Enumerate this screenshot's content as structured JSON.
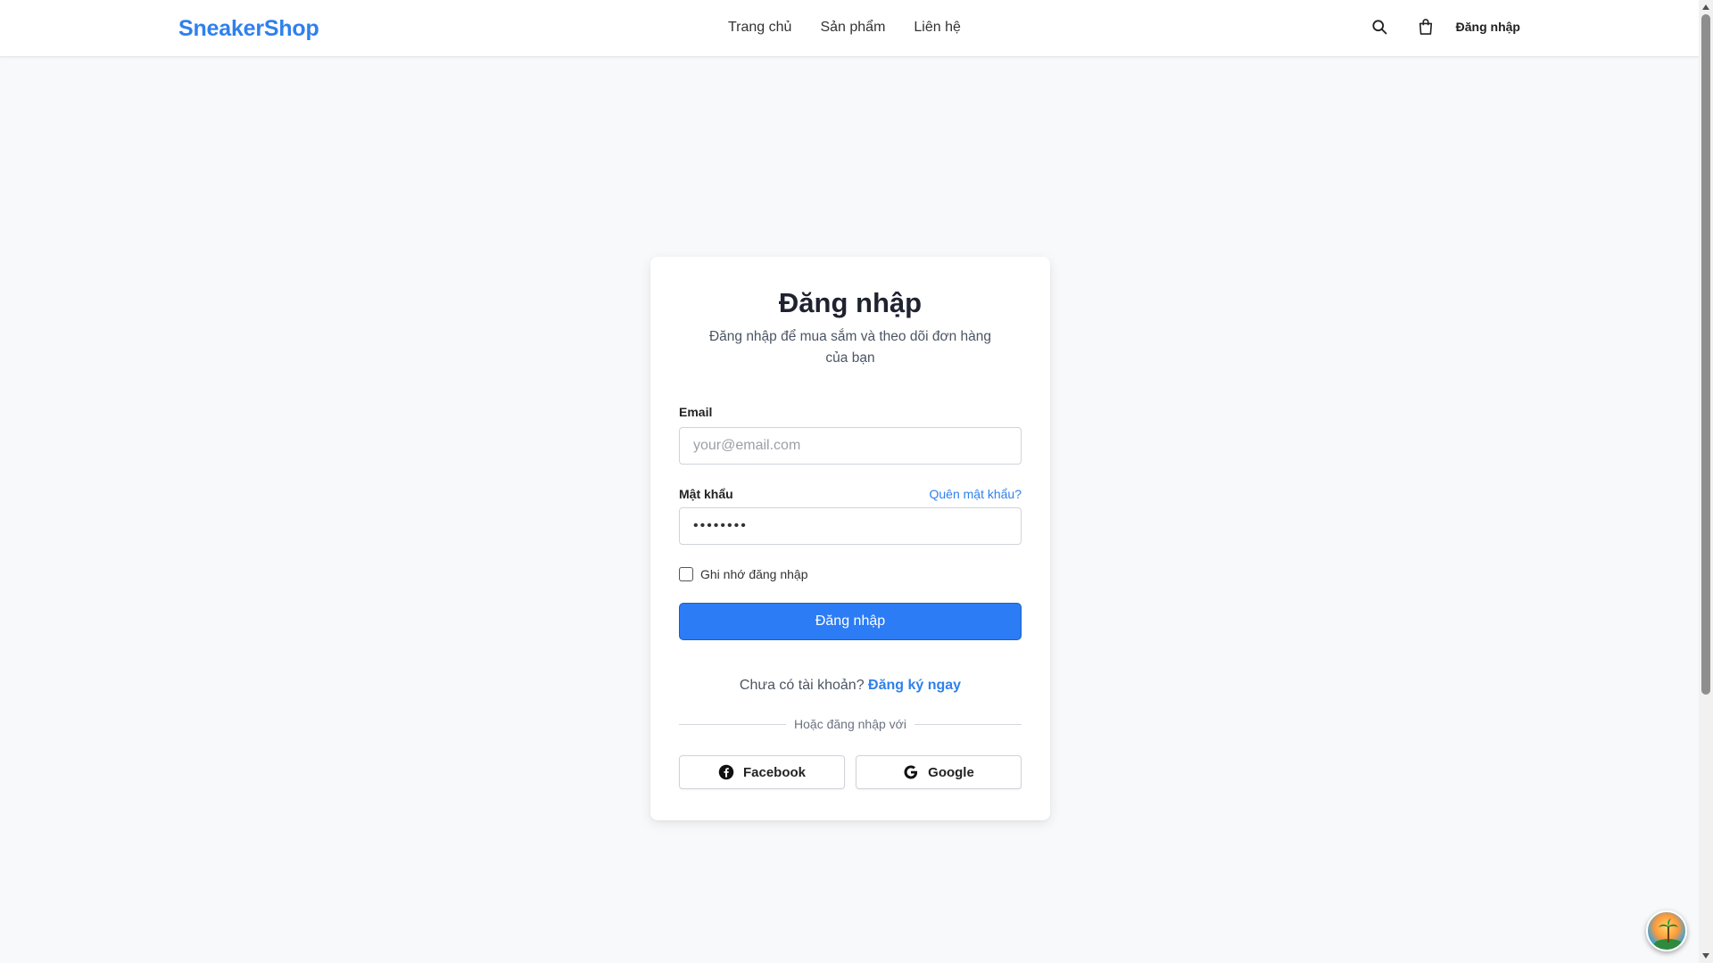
{
  "header": {
    "logo": "SneakerShop",
    "nav": [
      "Trang chủ",
      "Sản phẩm",
      "Liên hệ"
    ],
    "icons": [
      "search-icon",
      "shopping-bag-icon"
    ],
    "login_link": "Đăng nhập"
  },
  "login_card": {
    "title": "Đăng nhập",
    "subtitle": "Đăng nhập để mua sắm và theo dõi đơn hàng của bạn",
    "email": {
      "label": "Email",
      "placeholder": "your@email.com",
      "value": ""
    },
    "password": {
      "label": "Mật khẩu",
      "forgot_link": "Quên mật khẩu?",
      "value": "••••••••"
    },
    "remember_me": {
      "label": "Ghi nhớ đăng nhập",
      "checked": false
    },
    "submit_label": "Đăng nhập",
    "register_prompt": "Chưa có tài khoản?",
    "register_link": "Đăng ký ngay",
    "divider_text": "Hoặc đăng nhập với",
    "social_buttons": [
      {
        "label": "Facebook",
        "icon": "facebook-icon"
      },
      {
        "label": "Google",
        "icon": "google-icon"
      }
    ]
  },
  "colors": {
    "brand": "#2f80ed",
    "primary_button": "#2c7cf6",
    "page_background": "#f8f9fa"
  }
}
